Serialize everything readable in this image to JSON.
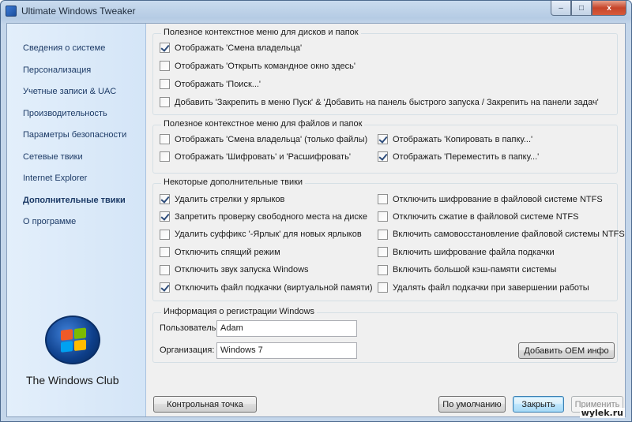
{
  "window": {
    "title": "Ultimate Windows Tweaker",
    "close_glyph": "x",
    "maximize_glyph": "□",
    "minimize_glyph": "–"
  },
  "sidebar": {
    "items": [
      {
        "label": "Сведения о системе",
        "active": false
      },
      {
        "label": "Персонализация",
        "active": false
      },
      {
        "label": "Учетные записи & UAC",
        "active": false
      },
      {
        "label": "Производительность",
        "active": false
      },
      {
        "label": "Параметры безопасности",
        "active": false
      },
      {
        "label": "Сетевые твики",
        "active": false
      },
      {
        "label": "Internet Explorer",
        "active": false
      },
      {
        "label": "Дополнительные твики",
        "active": true
      },
      {
        "label": "О программе",
        "active": false
      }
    ],
    "brand": "The Windows Club"
  },
  "groups": {
    "disks": {
      "title": "Полезное контекстное меню для дисков и папок",
      "options": [
        {
          "label": "Отображать 'Смена владельца'",
          "checked": true
        },
        {
          "label": "Отображать 'Открыть командное окно здесь'",
          "checked": false
        },
        {
          "label": "Отображать 'Поиск...'",
          "checked": false
        },
        {
          "label": "Добавить 'Закрепить в меню Пуск' & 'Добавить на панель быстрого запуска / Закрепить на панели задач'",
          "checked": false
        }
      ]
    },
    "files": {
      "title": "Полезное контекстное меню для файлов и папок",
      "options": [
        {
          "label": "Отображать 'Смена владельца' (только файлы)",
          "checked": false
        },
        {
          "label": "Отображать 'Шифровать' и 'Расшифровать'",
          "checked": false
        },
        {
          "label": "Отображать 'Копировать в папку...'",
          "checked": true
        },
        {
          "label": "Отображать 'Переместить в папку...'",
          "checked": true
        }
      ]
    },
    "extra": {
      "title": "Некоторые дополнительные твики",
      "left": [
        {
          "label": "Удалить стрелки у ярлыков",
          "checked": true
        },
        {
          "label": "Запретить проверку свободного места на диске",
          "checked": true
        },
        {
          "label": "Удалить суффикс '-Ярлык' для новых ярлыков",
          "checked": false
        },
        {
          "label": "Отключить спящий режим",
          "checked": false
        },
        {
          "label": "Отключить звук запуска Windows",
          "checked": false
        },
        {
          "label": "Отключить файл подкачки (виртуальной памяти)",
          "checked": true
        }
      ],
      "right": [
        {
          "label": "Отключить шифрование в файловой системе NTFS",
          "checked": false
        },
        {
          "label": "Отключить сжатие в файловой системе NTFS",
          "checked": false
        },
        {
          "label": "Включить самовосстановление файловой системы NTFS",
          "checked": false
        },
        {
          "label": "Включить шифрование файла подкачки",
          "checked": false
        },
        {
          "label": "Включить большой кэш-памяти системы",
          "checked": false
        },
        {
          "label": "Удалять файл подкачки при завершении работы",
          "checked": false
        }
      ]
    },
    "registration": {
      "title": "Информация о регистрации Windows",
      "user_label": "Пользователь:",
      "user_value": "Adam",
      "org_label": "Организация:",
      "org_value": "Windows 7",
      "oem_button": "Добавить OEM инфо"
    }
  },
  "footer": {
    "restore_point": "Контрольная точка",
    "defaults": "По умолчанию",
    "close": "Закрыть",
    "apply": "Применить"
  },
  "watermark": "wylek.ru"
}
